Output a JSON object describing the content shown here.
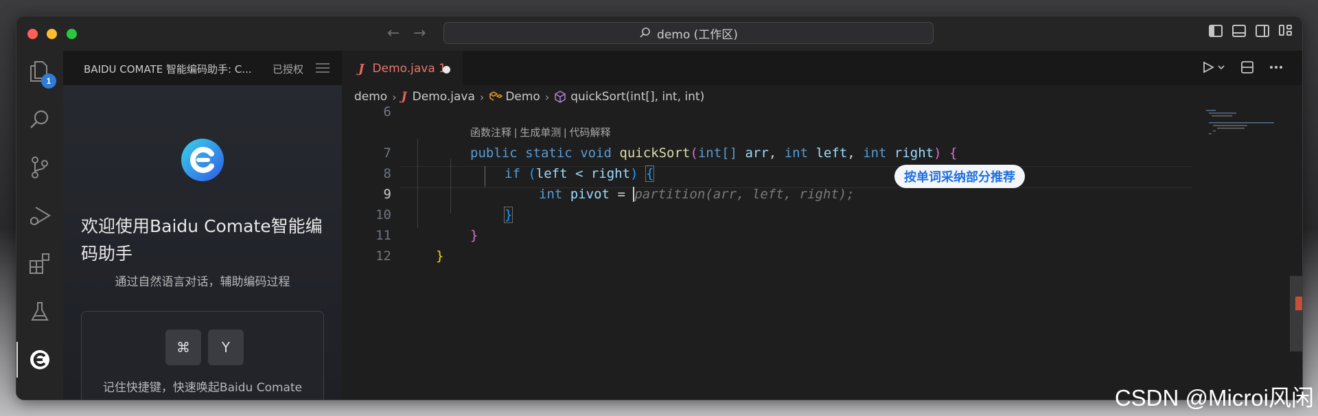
{
  "window": {
    "command_center": "demo (工作区)",
    "nav_back": "←",
    "nav_forward": "→"
  },
  "activity_bar": {
    "explorer_badge": "1",
    "items": [
      "explorer",
      "search",
      "source-control",
      "run-debug",
      "extensions",
      "testing",
      "comate"
    ],
    "active": "comate"
  },
  "sidebar": {
    "title": "BAIDU COMATE 智能编码助手: C...",
    "auth_status": "已授权",
    "welcome_title": "欢迎使用Baidu Comate智能编码助手",
    "subtitle": "通过自然语言对话，辅助编码过程",
    "shortcut_key1": "⌘",
    "shortcut_key2": "Y",
    "shortcut_hint": "记住快捷键，快速唤起Baidu Comate"
  },
  "editor": {
    "tab": {
      "icon": "J",
      "label": "Demo.java 1",
      "modified": true
    },
    "breadcrumb": [
      "demo",
      "Demo.java",
      "Demo",
      "quickSort(int[], int, int)"
    ],
    "codelens": "函数注释 | 生成单测 | 代码解释",
    "line_numbers": [
      "6",
      "7",
      "8",
      "9",
      "10",
      "11",
      "12"
    ],
    "current_line": "9",
    "code": {
      "l7": {
        "kw1": "public",
        "kw2": "static",
        "kw3": "void",
        "name": "quickSort",
        "type1": "int[]",
        "p1": "arr",
        "type2": "int",
        "p2": "left",
        "type3": "int",
        "p3": "right"
      },
      "l8": {
        "kw": "if",
        "cond": "left < right"
      },
      "l9": {
        "kw": "int",
        "var": "pivot",
        "op": "=",
        "suggestion": "partition(arr, left, right);"
      },
      "l10": "}",
      "l11": "}",
      "l12": "}"
    },
    "inline_hint": "按单词采纳部分推荐"
  },
  "colors": {
    "accent": "#2f7bd6",
    "tab_modified": "#e8756c",
    "hint_text": "#1f6fe0"
  },
  "watermark": "CSDN @Microi风闲"
}
